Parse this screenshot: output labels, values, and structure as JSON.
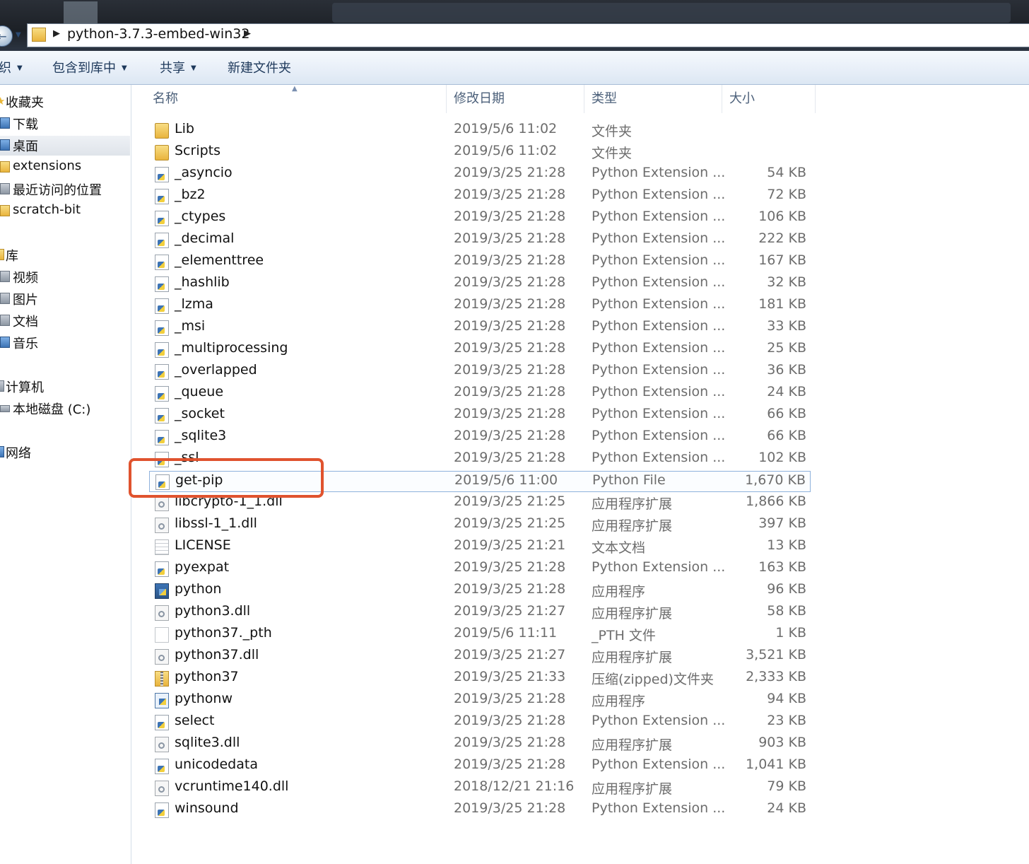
{
  "address": {
    "path": "python-3.7.3-embed-win32"
  },
  "toolbar": {
    "organize": "织",
    "include_in_library": "包含到库中",
    "share": "共享",
    "new_folder": "新建文件夹"
  },
  "nav": {
    "favorites": "收藏夹",
    "downloads": "下载",
    "desktop": "桌面",
    "extensions": "extensions",
    "recent": "最近访问的位置",
    "scratch_bit": "scratch-bit",
    "libraries": "库",
    "videos": "视频",
    "pictures": "图片",
    "documents": "文档",
    "music": "音乐",
    "computer": "计算机",
    "local_disk": "本地磁盘 (C:)",
    "network": "网络"
  },
  "columns": {
    "name": "名称",
    "modified": "修改日期",
    "type": "类型",
    "size": "大小"
  },
  "files": [
    {
      "name": "Lib",
      "date": "2019/5/6 11:02",
      "type": "文件夹",
      "size": "",
      "icon": "folder"
    },
    {
      "name": "Scripts",
      "date": "2019/5/6 11:02",
      "type": "文件夹",
      "size": "",
      "icon": "folder"
    },
    {
      "name": "_asyncio",
      "date": "2019/3/25 21:28",
      "type": "Python Extension ...",
      "size": "54 KB",
      "icon": "pyd"
    },
    {
      "name": "_bz2",
      "date": "2019/3/25 21:28",
      "type": "Python Extension ...",
      "size": "72 KB",
      "icon": "pyd"
    },
    {
      "name": "_ctypes",
      "date": "2019/3/25 21:28",
      "type": "Python Extension ...",
      "size": "106 KB",
      "icon": "pyd"
    },
    {
      "name": "_decimal",
      "date": "2019/3/25 21:28",
      "type": "Python Extension ...",
      "size": "222 KB",
      "icon": "pyd"
    },
    {
      "name": "_elementtree",
      "date": "2019/3/25 21:28",
      "type": "Python Extension ...",
      "size": "167 KB",
      "icon": "pyd"
    },
    {
      "name": "_hashlib",
      "date": "2019/3/25 21:28",
      "type": "Python Extension ...",
      "size": "32 KB",
      "icon": "pyd"
    },
    {
      "name": "_lzma",
      "date": "2019/3/25 21:28",
      "type": "Python Extension ...",
      "size": "181 KB",
      "icon": "pyd"
    },
    {
      "name": "_msi",
      "date": "2019/3/25 21:28",
      "type": "Python Extension ...",
      "size": "33 KB",
      "icon": "pyd"
    },
    {
      "name": "_multiprocessing",
      "date": "2019/3/25 21:28",
      "type": "Python Extension ...",
      "size": "25 KB",
      "icon": "pyd"
    },
    {
      "name": "_overlapped",
      "date": "2019/3/25 21:28",
      "type": "Python Extension ...",
      "size": "36 KB",
      "icon": "pyd"
    },
    {
      "name": "_queue",
      "date": "2019/3/25 21:28",
      "type": "Python Extension ...",
      "size": "24 KB",
      "icon": "pyd"
    },
    {
      "name": "_socket",
      "date": "2019/3/25 21:28",
      "type": "Python Extension ...",
      "size": "66 KB",
      "icon": "pyd"
    },
    {
      "name": "_sqlite3",
      "date": "2019/3/25 21:28",
      "type": "Python Extension ...",
      "size": "66 KB",
      "icon": "pyd"
    },
    {
      "name": "_ssl",
      "date": "2019/3/25 21:28",
      "type": "Python Extension ...",
      "size": "102 KB",
      "icon": "pyd"
    },
    {
      "name": "get-pip",
      "date": "2019/5/6 11:00",
      "type": "Python File",
      "size": "1,670 KB",
      "icon": "pyd"
    },
    {
      "name": "libcrypto-1_1.dll",
      "date": "2019/3/25 21:25",
      "type": "应用程序扩展",
      "size": "1,866 KB",
      "icon": "dll"
    },
    {
      "name": "libssl-1_1.dll",
      "date": "2019/3/25 21:25",
      "type": "应用程序扩展",
      "size": "397 KB",
      "icon": "dll"
    },
    {
      "name": "LICENSE",
      "date": "2019/3/25 21:21",
      "type": "文本文档",
      "size": "13 KB",
      "icon": "txt"
    },
    {
      "name": "pyexpat",
      "date": "2019/3/25 21:28",
      "type": "Python Extension ...",
      "size": "163 KB",
      "icon": "pyd"
    },
    {
      "name": "python",
      "date": "2019/3/25 21:28",
      "type": "应用程序",
      "size": "96 KB",
      "icon": "exe"
    },
    {
      "name": "python3.dll",
      "date": "2019/3/25 21:27",
      "type": "应用程序扩展",
      "size": "58 KB",
      "icon": "dll"
    },
    {
      "name": "python37._pth",
      "date": "2019/5/6 11:11",
      "type": "_PTH 文件",
      "size": "1 KB",
      "icon": "blank"
    },
    {
      "name": "python37.dll",
      "date": "2019/3/25 21:27",
      "type": "应用程序扩展",
      "size": "3,521 KB",
      "icon": "dll"
    },
    {
      "name": "python37",
      "date": "2019/3/25 21:33",
      "type": "压缩(zipped)文件夹",
      "size": "2,333 KB",
      "icon": "zip"
    },
    {
      "name": "pythonw",
      "date": "2019/3/25 21:28",
      "type": "应用程序",
      "size": "94 KB",
      "icon": "exew"
    },
    {
      "name": "select",
      "date": "2019/3/25 21:28",
      "type": "Python Extension ...",
      "size": "23 KB",
      "icon": "pyd"
    },
    {
      "name": "sqlite3.dll",
      "date": "2019/3/25 21:28",
      "type": "应用程序扩展",
      "size": "903 KB",
      "icon": "dll"
    },
    {
      "name": "unicodedata",
      "date": "2019/3/25 21:28",
      "type": "Python Extension ...",
      "size": "1,041 KB",
      "icon": "pyd"
    },
    {
      "name": "vcruntime140.dll",
      "date": "2018/12/21 21:16",
      "type": "应用程序扩展",
      "size": "79 KB",
      "icon": "dll"
    },
    {
      "name": "winsound",
      "date": "2019/3/25 21:28",
      "type": "Python Extension ...",
      "size": "24 KB",
      "icon": "pyd"
    }
  ],
  "highlight": {
    "file": "get-pip",
    "color": "#e0532e"
  }
}
